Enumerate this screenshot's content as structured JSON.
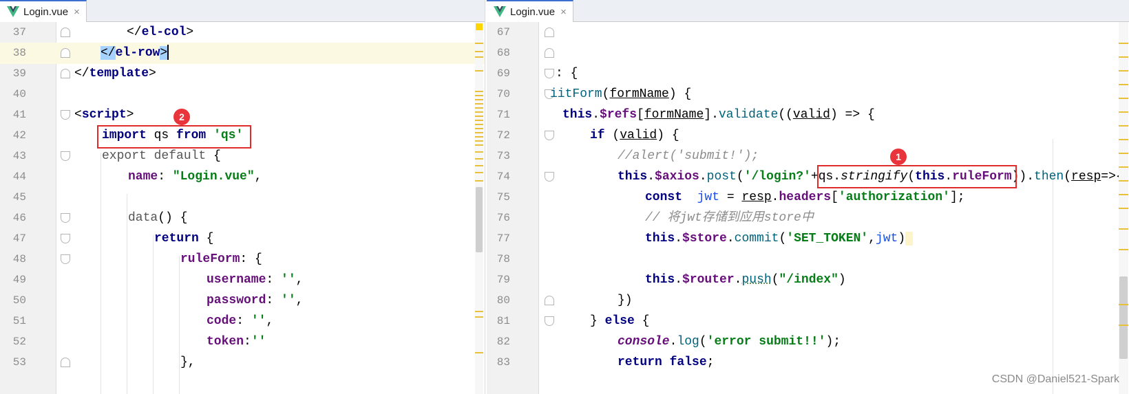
{
  "left": {
    "tab_label": "Login.vue",
    "lines": [
      {
        "n": "37",
        "code": "</el-col>"
      },
      {
        "n": "38",
        "code": "</el-row>"
      },
      {
        "n": "39",
        "code": "</template>"
      },
      {
        "n": "40",
        "code": ""
      },
      {
        "n": "41",
        "code": "<script>"
      },
      {
        "n": "42",
        "code": "import qs from 'qs'"
      },
      {
        "n": "43",
        "code": "export default {"
      },
      {
        "n": "44",
        "code": "name: \"Login.vue\","
      },
      {
        "n": "45",
        "code": ""
      },
      {
        "n": "46",
        "code": "data() {"
      },
      {
        "n": "47",
        "code": "return {"
      },
      {
        "n": "48",
        "code": "ruleForm: {"
      },
      {
        "n": "49",
        "code": "username: '',"
      },
      {
        "n": "50",
        "code": "password: '',"
      },
      {
        "n": "51",
        "code": "code: '',"
      },
      {
        "n": "52",
        "code": "token:''"
      },
      {
        "n": "53",
        "code": "},"
      }
    ],
    "badge": "2"
  },
  "right": {
    "tab_label": "Login.vue",
    "lines": [
      {
        "n": "67",
        "code": ""
      },
      {
        "n": "68",
        "code": ""
      },
      {
        "n": "69",
        "code": ": {"
      },
      {
        "n": "70",
        "code": "iitForm(formName) {"
      },
      {
        "n": "71",
        "code": "this.$refs[formName].validate((valid) => {"
      },
      {
        "n": "72",
        "code": "if (valid) {"
      },
      {
        "n": "73",
        "code": "//alert('submit!');"
      },
      {
        "n": "74",
        "code": "this.$axios.post('/login?'+qs.stringify(this.ruleForm)).then(resp=>{"
      },
      {
        "n": "75",
        "code": "const jwt = resp.headers['authorization'];"
      },
      {
        "n": "76",
        "code": "// 将jwt存储到应用store中"
      },
      {
        "n": "77",
        "code": "this.$store.commit('SET_TOKEN',jwt)"
      },
      {
        "n": "78",
        "code": ""
      },
      {
        "n": "79",
        "code": "this.$router.push(\"/index\")"
      },
      {
        "n": "80",
        "code": "})"
      },
      {
        "n": "81",
        "code": "} else {"
      },
      {
        "n": "82",
        "code": "console.log('error submit!!');"
      },
      {
        "n": "83",
        "code": "return false;"
      }
    ],
    "badge": "1"
  },
  "watermark": "CSDN @Daniel521-Spark",
  "colors": {
    "tab_accent": "#3b6ecf",
    "highlight_box": "#e02b2b",
    "badge": "#e8343a",
    "vue_green": "#41b883",
    "vue_dark": "#35495e"
  },
  "icons": {
    "tab_icon": "vue-logo-icon",
    "tab_close": "close-icon"
  }
}
